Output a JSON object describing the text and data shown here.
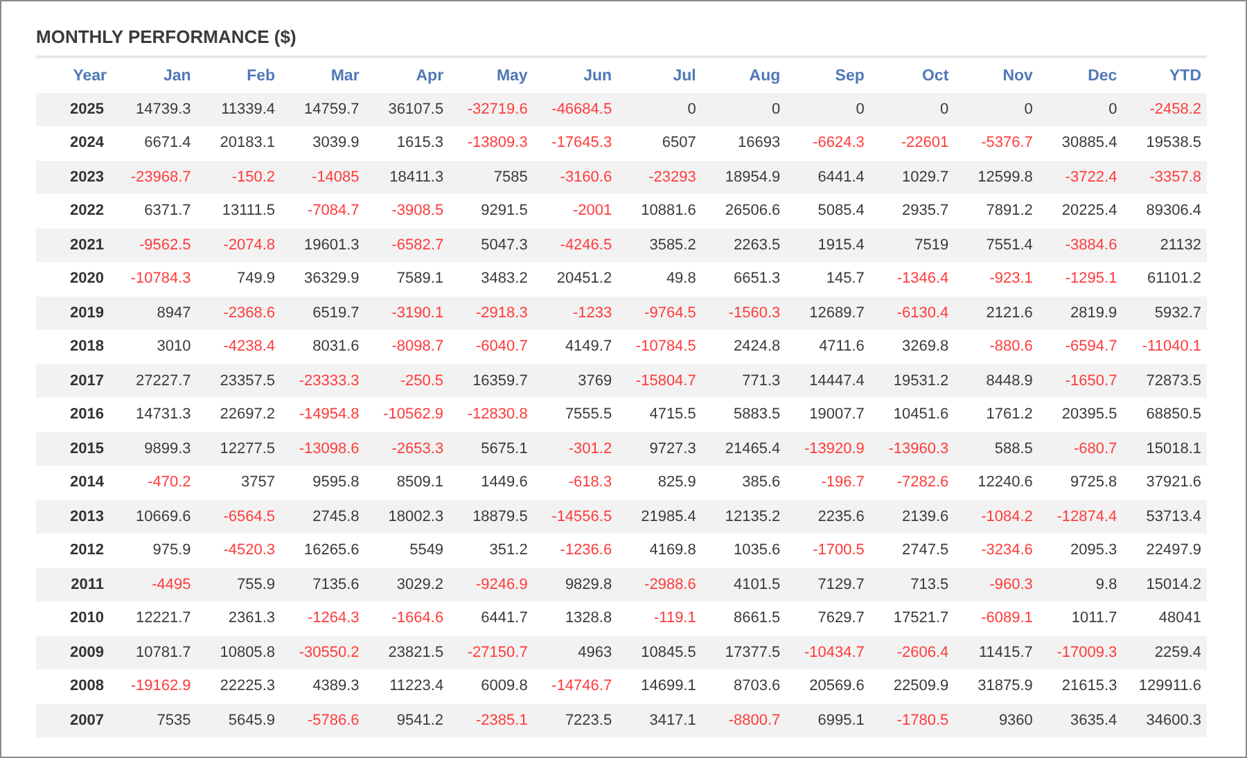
{
  "title": "MONTHLY PERFORMANCE ($)",
  "table": {
    "columns": [
      "Year",
      "Jan",
      "Feb",
      "Mar",
      "Apr",
      "May",
      "Jun",
      "Jul",
      "Aug",
      "Sep",
      "Oct",
      "Nov",
      "Dec",
      "YTD"
    ],
    "rows": [
      {
        "cells": [
          "2025",
          "14739.3",
          "11339.4",
          "14759.7",
          "36107.5",
          "-32719.6",
          "-46684.5",
          "0",
          "0",
          "0",
          "0",
          "0",
          "0",
          "-2458.2"
        ]
      },
      {
        "cells": [
          "2024",
          "6671.4",
          "20183.1",
          "3039.9",
          "1615.3",
          "-13809.3",
          "-17645.3",
          "6507",
          "16693",
          "-6624.3",
          "-22601",
          "-5376.7",
          "30885.4",
          "19538.5"
        ]
      },
      {
        "cells": [
          "2023",
          "-23968.7",
          "-150.2",
          "-14085",
          "18411.3",
          "7585",
          "-3160.6",
          "-23293",
          "18954.9",
          "6441.4",
          "1029.7",
          "12599.8",
          "-3722.4",
          "-3357.8"
        ]
      },
      {
        "cells": [
          "2022",
          "6371.7",
          "13111.5",
          "-7084.7",
          "-3908.5",
          "9291.5",
          "-2001",
          "10881.6",
          "26506.6",
          "5085.4",
          "2935.7",
          "7891.2",
          "20225.4",
          "89306.4"
        ]
      },
      {
        "cells": [
          "2021",
          "-9562.5",
          "-2074.8",
          "19601.3",
          "-6582.7",
          "5047.3",
          "-4246.5",
          "3585.2",
          "2263.5",
          "1915.4",
          "7519",
          "7551.4",
          "-3884.6",
          "21132"
        ]
      },
      {
        "cells": [
          "2020",
          "-10784.3",
          "749.9",
          "36329.9",
          "7589.1",
          "3483.2",
          "20451.2",
          "49.8",
          "6651.3",
          "145.7",
          "-1346.4",
          "-923.1",
          "-1295.1",
          "61101.2"
        ]
      },
      {
        "cells": [
          "2019",
          "8947",
          "-2368.6",
          "6519.7",
          "-3190.1",
          "-2918.3",
          "-1233",
          "-9764.5",
          "-1560.3",
          "12689.7",
          "-6130.4",
          "2121.6",
          "2819.9",
          "5932.7"
        ]
      },
      {
        "cells": [
          "2018",
          "3010",
          "-4238.4",
          "8031.6",
          "-8098.7",
          "-6040.7",
          "4149.7",
          "-10784.5",
          "2424.8",
          "4711.6",
          "3269.8",
          "-880.6",
          "-6594.7",
          "-11040.1"
        ]
      },
      {
        "cells": [
          "2017",
          "27227.7",
          "23357.5",
          "-23333.3",
          "-250.5",
          "16359.7",
          "3769",
          "-15804.7",
          "771.3",
          "14447.4",
          "19531.2",
          "8448.9",
          "-1650.7",
          "72873.5"
        ]
      },
      {
        "cells": [
          "2016",
          "14731.3",
          "22697.2",
          "-14954.8",
          "-10562.9",
          "-12830.8",
          "7555.5",
          "4715.5",
          "5883.5",
          "19007.7",
          "10451.6",
          "1761.2",
          "20395.5",
          "68850.5"
        ]
      },
      {
        "cells": [
          "2015",
          "9899.3",
          "12277.5",
          "-13098.6",
          "-2653.3",
          "5675.1",
          "-301.2",
          "9727.3",
          "21465.4",
          "-13920.9",
          "-13960.3",
          "588.5",
          "-680.7",
          "15018.1"
        ]
      },
      {
        "cells": [
          "2014",
          "-470.2",
          "3757",
          "9595.8",
          "8509.1",
          "1449.6",
          "-618.3",
          "825.9",
          "385.6",
          "-196.7",
          "-7282.6",
          "12240.6",
          "9725.8",
          "37921.6"
        ]
      },
      {
        "cells": [
          "2013",
          "10669.6",
          "-6564.5",
          "2745.8",
          "18002.3",
          "18879.5",
          "-14556.5",
          "21985.4",
          "12135.2",
          "2235.6",
          "2139.6",
          "-1084.2",
          "-12874.4",
          "53713.4"
        ]
      },
      {
        "cells": [
          "2012",
          "975.9",
          "-4520.3",
          "16265.6",
          "5549",
          "351.2",
          "-1236.6",
          "4169.8",
          "1035.6",
          "-1700.5",
          "2747.5",
          "-3234.6",
          "2095.3",
          "22497.9"
        ]
      },
      {
        "cells": [
          "2011",
          "-4495",
          "755.9",
          "7135.6",
          "3029.2",
          "-9246.9",
          "9829.8",
          "-2988.6",
          "4101.5",
          "7129.7",
          "713.5",
          "-960.3",
          "9.8",
          "15014.2"
        ]
      },
      {
        "cells": [
          "2010",
          "12221.7",
          "2361.3",
          "-1264.3",
          "-1664.6",
          "6441.7",
          "1328.8",
          "-119.1",
          "8661.5",
          "7629.7",
          "17521.7",
          "-6089.1",
          "1011.7",
          "48041"
        ]
      },
      {
        "cells": [
          "2009",
          "10781.7",
          "10805.8",
          "-30550.2",
          "23821.5",
          "-27150.7",
          "4963",
          "10845.5",
          "17377.5",
          "-10434.7",
          "-2606.4",
          "11415.7",
          "-17009.3",
          "2259.4"
        ]
      },
      {
        "cells": [
          "2008",
          "-19162.9",
          "22225.3",
          "4389.3",
          "11223.4",
          "6009.8",
          "-14746.7",
          "14699.1",
          "8703.6",
          "20569.6",
          "22509.9",
          "31875.9",
          "21615.3",
          "129911.6"
        ]
      },
      {
        "cells": [
          "2007",
          "7535",
          "5645.9",
          "-5786.6",
          "9541.2",
          "-2385.1",
          "7223.5",
          "3417.1",
          "-8800.7",
          "6995.1",
          "-1780.5",
          "9360",
          "3635.4",
          "34600.3"
        ]
      }
    ]
  }
}
